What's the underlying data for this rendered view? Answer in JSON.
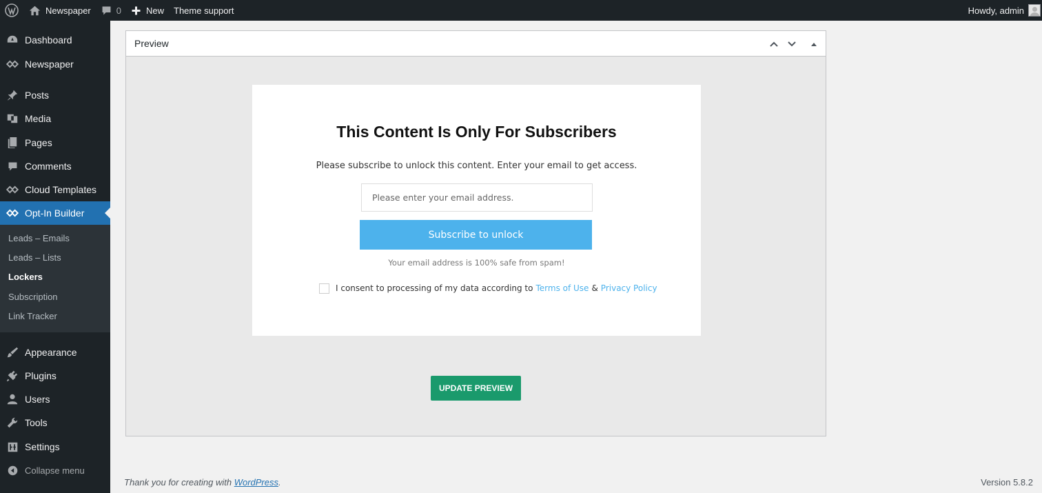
{
  "adminbar": {
    "wp_logo_icon": "wordpress-icon",
    "site_name": "Newspaper",
    "comments_count": "0",
    "new_label": "New",
    "theme_support": "Theme support",
    "howdy": "Howdy, admin"
  },
  "sidebar": {
    "items": [
      {
        "label": "Dashboard",
        "icon": "dashboard-icon"
      },
      {
        "label": "Newspaper",
        "icon": "newspaper-icon"
      },
      {
        "label": "Posts",
        "icon": "pin-icon"
      },
      {
        "label": "Media",
        "icon": "media-icon"
      },
      {
        "label": "Pages",
        "icon": "pages-icon"
      },
      {
        "label": "Comments",
        "icon": "comments-icon"
      },
      {
        "label": "Cloud Templates",
        "icon": "cloud-templates-icon"
      },
      {
        "label": "Opt-In Builder",
        "icon": "optin-icon"
      },
      {
        "label": "Appearance",
        "icon": "brush-icon"
      },
      {
        "label": "Plugins",
        "icon": "plugin-icon"
      },
      {
        "label": "Users",
        "icon": "user-icon"
      },
      {
        "label": "Tools",
        "icon": "wrench-icon"
      },
      {
        "label": "Settings",
        "icon": "settings-icon"
      }
    ],
    "submenu": [
      "Leads – Emails",
      "Leads – Lists",
      "Lockers",
      "Subscription",
      "Link Tracker"
    ],
    "collapse": "Collapse menu",
    "accent_color": "#2271b1"
  },
  "preview": {
    "title": "Preview",
    "locker": {
      "heading": "This Content Is Only For Subscribers",
      "description": "Please subscribe to unlock this content. Enter your email to get access.",
      "email_placeholder": "Please enter your email address.",
      "button": "Subscribe to unlock",
      "note": "Your email address is 100% safe from spam!",
      "consent_text": "I consent to processing of my data according to",
      "terms": "Terms of Use",
      "amp": "&",
      "privacy": "Privacy Policy",
      "button_color": "#4db2ec"
    },
    "update_button": "UPDATE PREVIEW",
    "update_color": "#1a9a6c"
  },
  "footer": {
    "thanks_prefix": "Thank you for creating with",
    "wordpress_link": "WordPress",
    "thanks_suffix": ".",
    "version": "Version 5.8.2"
  }
}
